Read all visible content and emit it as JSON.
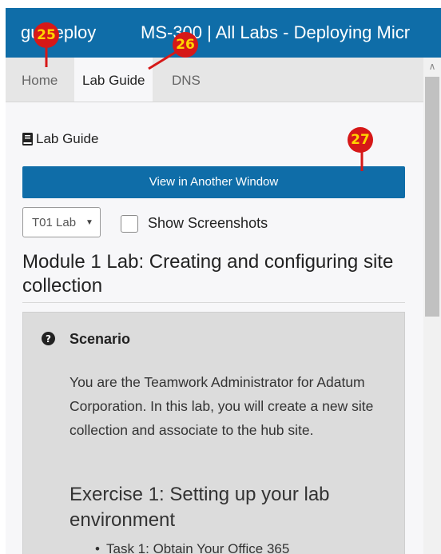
{
  "titlebar": {
    "brand": "guideploy",
    "title": "MS-300 | All Labs - Deploying Micr"
  },
  "tabs": [
    {
      "label": "Home"
    },
    {
      "label": "Lab Guide"
    },
    {
      "label": "DNS"
    }
  ],
  "content": {
    "heading": "Lab Guide",
    "view_button": "View in Another Window",
    "lab_select": "T01 Lab",
    "show_screenshots": "Show Screenshots",
    "module_title": "Module 1 Lab: Creating and configuring site collection",
    "scenario": {
      "title": "Scenario",
      "text": "You are the Teamwork Administrator for Adatum Corporation. In this lab, you will create a new site collection and associate to the hub site.",
      "exercise_title": "Exercise 1: Setting up your lab environment",
      "task": "Task 1: Obtain Your Office 365"
    }
  },
  "annotations": [
    "25",
    "26",
    "27"
  ],
  "colors": {
    "brand_blue": "#0f6da8",
    "annotation_red": "#d61818",
    "annotation_text": "#ffd400"
  }
}
